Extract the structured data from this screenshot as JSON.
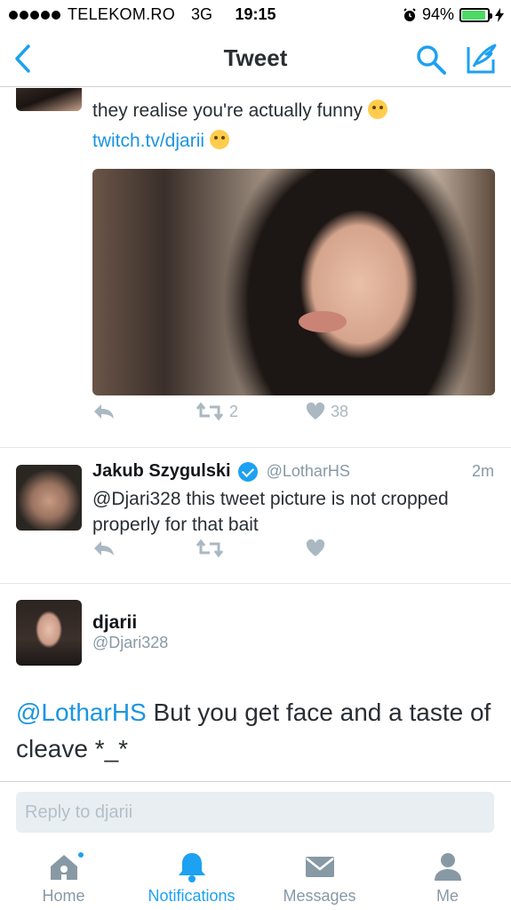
{
  "status_bar": {
    "carrier": "TELEKOM.RO",
    "network": "3G",
    "time": "19:15",
    "battery_percent": "94%",
    "battery_level": 0.94,
    "icons": [
      "signal-dots-icon",
      "alarm-clock-icon",
      "battery-icon",
      "charging-bolt-icon"
    ]
  },
  "nav": {
    "title": "Tweet",
    "back_icon": "chevron-left-icon",
    "search_icon": "search-icon",
    "compose_icon": "compose-tweet-icon"
  },
  "previous_tweet": {
    "line1": "they realise you're actually funny",
    "link": "twitch.tv/djarii",
    "actions": {
      "retweets": "2",
      "likes": "38"
    }
  },
  "reply_tweet": {
    "name": "Jakub Szygulski",
    "verified": true,
    "handle": "@LotharHS",
    "time": "2m",
    "text": "@Djari328 this tweet picture is not cropped properly for that bait"
  },
  "main_tweet": {
    "name": "djarii",
    "handle": "@Djari328",
    "mention": "@LotharHS",
    "text": " But you get face and a taste of cleave *_*"
  },
  "reply_box": {
    "placeholder": "Reply to djarii"
  },
  "tabs": [
    {
      "label": "Home",
      "icon": "home-icon",
      "active": false,
      "has_dot": true
    },
    {
      "label": "Notifications",
      "icon": "bell-icon",
      "active": true,
      "has_dot": false
    },
    {
      "label": "Messages",
      "icon": "envelope-icon",
      "active": false,
      "has_dot": false
    },
    {
      "label": "Me",
      "icon": "person-icon",
      "active": false,
      "has_dot": false
    }
  ],
  "colors": {
    "accent": "#1da1f2",
    "link": "#1b95e0",
    "muted": "#8899a6",
    "icon_gray": "#aab8c2"
  }
}
